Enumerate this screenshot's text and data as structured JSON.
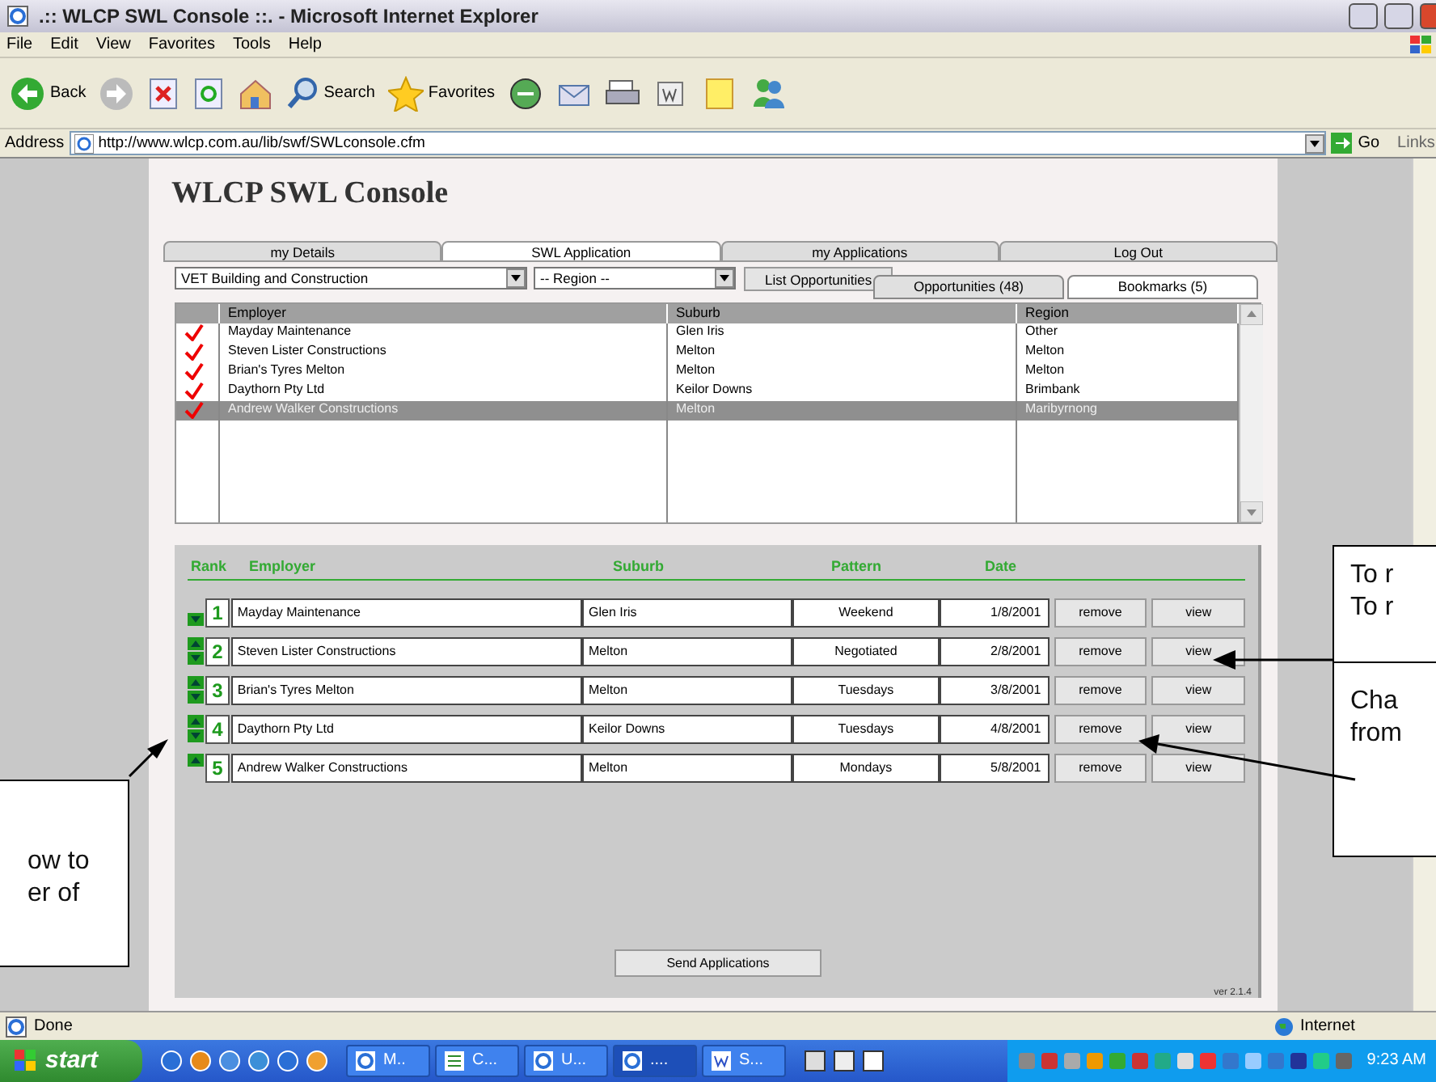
{
  "window": {
    "title": ".:: WLCP SWL Console ::. - Microsoft Internet Explorer"
  },
  "menu": [
    "File",
    "Edit",
    "View",
    "Favorites",
    "Tools",
    "Help"
  ],
  "toolbar": [
    {
      "kind": "back",
      "label": "Back"
    },
    {
      "kind": "forward"
    },
    {
      "kind": "stop"
    },
    {
      "kind": "refresh"
    },
    {
      "kind": "home"
    },
    {
      "kind": "search",
      "label": "Search"
    },
    {
      "kind": "favorites",
      "label": "Favorites"
    },
    {
      "kind": "media"
    },
    {
      "kind": "mail"
    },
    {
      "kind": "print"
    },
    {
      "kind": "edit"
    },
    {
      "kind": "note"
    },
    {
      "kind": "messenger"
    }
  ],
  "address": {
    "label": "Address",
    "url": "http://www.wlcp.com.au/lib/swf/SWLconsole.cfm",
    "go": "Go",
    "links": "Links"
  },
  "page": {
    "title": "WLCP SWL Console",
    "tabs": [
      {
        "label": "my Details",
        "selected": false
      },
      {
        "label": "SWL Application",
        "selected": true
      },
      {
        "label": "my Applications",
        "selected": false
      },
      {
        "label": "Log Out",
        "selected": false
      }
    ],
    "filters": {
      "course": "VET Building and Construction",
      "region": "-- Region --",
      "button": "List Opportunities"
    },
    "subtabs": [
      {
        "label": "Opportunities (48)",
        "selected": false
      },
      {
        "label": "Bookmarks (5)",
        "selected": true
      }
    ],
    "list": {
      "columns": [
        "Employer",
        "Suburb",
        "Region"
      ],
      "rows": [
        {
          "employer": "Mayday Maintenance",
          "suburb": "Glen Iris",
          "region": "Other",
          "checked": true,
          "selected": false
        },
        {
          "employer": "Steven Lister Constructions",
          "suburb": "Melton",
          "region": "Melton",
          "checked": true,
          "selected": false
        },
        {
          "employer": "Brian's Tyres Melton",
          "suburb": "Melton",
          "region": "Melton",
          "checked": true,
          "selected": false
        },
        {
          "employer": "Daythorn Pty Ltd",
          "suburb": "Keilor Downs",
          "region": "Brimbank",
          "checked": true,
          "selected": false
        },
        {
          "employer": "Andrew Walker Constructions",
          "suburb": "Melton",
          "region": "Maribyrnong",
          "checked": true,
          "selected": true
        }
      ]
    },
    "applications": {
      "columns": [
        "Rank",
        "Employer",
        "Suburb",
        "Pattern",
        "Date"
      ],
      "rows": [
        {
          "rank": "1",
          "employer": "Mayday Maintenance",
          "suburb": "Glen Iris",
          "pattern": "Weekend",
          "date": "1/8/2001",
          "can_up": false,
          "can_down": true,
          "remove": "remove",
          "view": "view"
        },
        {
          "rank": "2",
          "employer": "Steven Lister Constructions",
          "suburb": "Melton",
          "pattern": "Negotiated",
          "date": "2/8/2001",
          "can_up": true,
          "can_down": true,
          "remove": "remove",
          "view": "view"
        },
        {
          "rank": "3",
          "employer": "Brian's Tyres Melton",
          "suburb": "Melton",
          "pattern": "Tuesdays",
          "date": "3/8/2001",
          "can_up": true,
          "can_down": true,
          "remove": "remove",
          "view": "view"
        },
        {
          "rank": "4",
          "employer": "Daythorn Pty Ltd",
          "suburb": "Keilor Downs",
          "pattern": "Tuesdays",
          "date": "4/8/2001",
          "can_up": true,
          "can_down": true,
          "remove": "remove",
          "view": "view"
        },
        {
          "rank": "5",
          "employer": "Andrew Walker Constructions",
          "suburb": "Melton",
          "pattern": "Mondays",
          "date": "5/8/2001",
          "can_up": true,
          "can_down": false,
          "remove": "remove",
          "view": "view"
        }
      ],
      "send": "Send Applications",
      "version": "ver 2.1.4"
    }
  },
  "callouts": {
    "left": [
      "ow to",
      "er of"
    ],
    "right_top": [
      "To r",
      "To r"
    ],
    "right_bottom": [
      "Cha",
      "from"
    ]
  },
  "status_bar": {
    "text": "Done",
    "zone": "Internet"
  },
  "taskbar": {
    "start": "start",
    "tasks": [
      {
        "kind": "browser",
        "label": "M..",
        "selected": false
      },
      {
        "kind": "sheet",
        "label": "C...",
        "selected": false
      },
      {
        "kind": "browser",
        "label": "U...",
        "selected": false
      },
      {
        "kind": "browser",
        "label": "....",
        "selected": true
      },
      {
        "kind": "doc",
        "label": "S...",
        "selected": false
      }
    ],
    "clock": "9:23 AM"
  }
}
